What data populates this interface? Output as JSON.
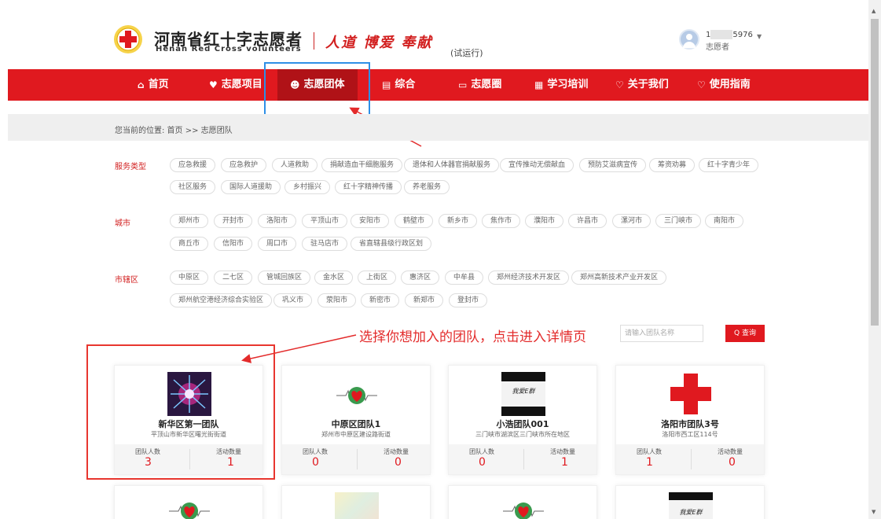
{
  "header": {
    "brand_cn": "河南省红十字志愿者",
    "brand_en": "Henan Red Cross volunteers",
    "slogan": "人道  博爱  奉献",
    "beta": "(试运行)",
    "user_id_prefix": "1",
    "user_id_suffix": "5976",
    "user_role": "志愿者"
  },
  "nav": {
    "items": [
      {
        "label": "首页",
        "icon": "home-icon"
      },
      {
        "label": "志愿项目",
        "icon": "heart-icon"
      },
      {
        "label": "志愿团体",
        "icon": "group-icon"
      },
      {
        "label": "综合",
        "icon": "document-icon"
      },
      {
        "label": "志愿圈",
        "icon": "chat-icon"
      },
      {
        "label": "学习培训",
        "icon": "book-icon"
      },
      {
        "label": "关于我们",
        "icon": "heart-outline-icon"
      },
      {
        "label": "使用指南",
        "icon": "heart-outline-icon"
      }
    ]
  },
  "breadcrumb": "您当前的位置: 首页 >> 志愿团队",
  "filters": {
    "service_label": "服务类型",
    "service_tags": [
      "应急救援",
      "应急救护",
      "人道救助",
      "捐献造血干细胞服务",
      "遗体和人体器官捐献服务",
      "宣传推动无偿献血",
      "预防艾滋病宣传",
      "筹资劝募",
      "红十字青少年",
      "社区服务",
      "国际人道援助",
      "乡村振兴",
      "红十字精神传播",
      "养老服务"
    ],
    "city_label": "城市",
    "city_tags": [
      "郑州市",
      "开封市",
      "洛阳市",
      "平顶山市",
      "安阳市",
      "鹤壁市",
      "新乡市",
      "焦作市",
      "濮阳市",
      "许昌市",
      "漯河市",
      "三门峡市",
      "南阳市",
      "商丘市",
      "信阳市",
      "周口市",
      "驻马店市",
      "省直辖县级行政区划"
    ],
    "district_label": "市辖区",
    "district_tags": [
      "中原区",
      "二七区",
      "管城回族区",
      "金水区",
      "上街区",
      "惠济区",
      "中牟县",
      "郑州经济技术开发区",
      "郑州高新技术产业开发区",
      "郑州航空港经济综合实验区",
      "巩义市",
      "荥阳市",
      "新密市",
      "新郑市",
      "登封市"
    ]
  },
  "annotation": "选择你想加入的团队，点击进入详情页",
  "search": {
    "placeholder": "请输入团队名称",
    "button": "Q 查询"
  },
  "teams": [
    {
      "name": "新华区第一团队",
      "addr": "平顶山市新华区曙光街街道",
      "members_label": "团队人数",
      "activities_label": "活动数量",
      "members": "3",
      "activities": "1"
    },
    {
      "name": "中原区团队1",
      "addr": "郑州市中原区建设路街道",
      "members_label": "团队人数",
      "activities_label": "活动数量",
      "members": "0",
      "activities": "0"
    },
    {
      "name": "小浩团队001",
      "addr": "三门峡市湖滨区三门峡市所在地区",
      "members_label": "团队人数",
      "activities_label": "活动数量",
      "members": "0",
      "activities": "1"
    },
    {
      "name": "洛阳市团队3号",
      "addr": "洛阳市西工区114号",
      "members_label": "团队人数",
      "activities_label": "活动数量",
      "members": "1",
      "activities": "0"
    }
  ],
  "thumb_text": "我爱E群",
  "colors": {
    "primary_red": "#e0191f",
    "dark_red": "#b01217",
    "highlight_blue": "#2e8fe6"
  }
}
